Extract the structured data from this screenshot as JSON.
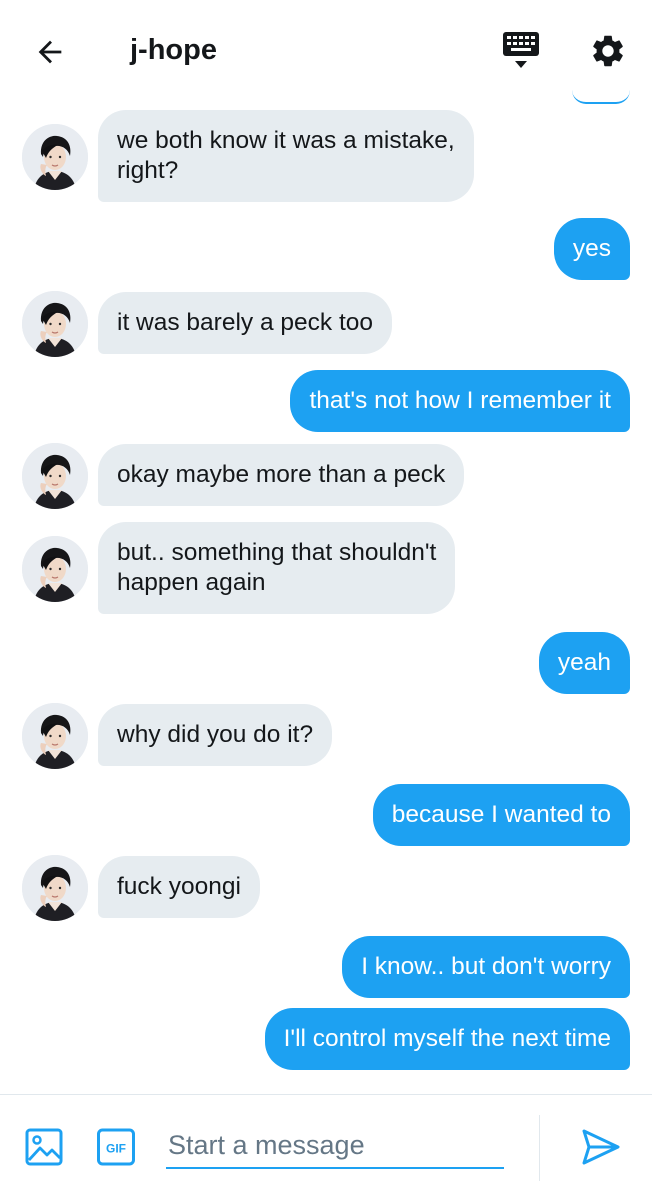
{
  "header": {
    "title": "j-hope",
    "back_icon": "arrow-left-icon",
    "keyboard_icon": "keyboard-icon",
    "settings_icon": "gear-icon"
  },
  "colors": {
    "accent": "#1da1f2",
    "incoming_bubble": "#e6ecf0",
    "text": "#14171a",
    "placeholder": "#657786"
  },
  "messages": [
    {
      "side": "in",
      "lines": [
        "we both know it was a mistake,",
        "right?"
      ]
    },
    {
      "side": "out",
      "lines": [
        "yes"
      ]
    },
    {
      "side": "in",
      "lines": [
        "it was barely a peck too"
      ]
    },
    {
      "side": "out",
      "lines": [
        "that's not how I remember it"
      ]
    },
    {
      "side": "in",
      "lines": [
        "okay maybe more than a peck"
      ]
    },
    {
      "side": "in",
      "lines": [
        "but.. something that shouldn't",
        "happen again"
      ]
    },
    {
      "side": "out",
      "lines": [
        "yeah"
      ]
    },
    {
      "side": "in",
      "lines": [
        "why did you do it?"
      ]
    },
    {
      "side": "out",
      "lines": [
        "because I wanted to"
      ]
    },
    {
      "side": "in",
      "lines": [
        "fuck yoongi"
      ]
    },
    {
      "side": "out",
      "lines": [
        "I know.. but don't worry"
      ]
    },
    {
      "side": "out",
      "lines": [
        "I'll control myself the next time"
      ]
    }
  ],
  "composer": {
    "placeholder": "Start a message",
    "value": "",
    "media_icon": "image-icon",
    "gif_icon": "gif-icon",
    "gif_label": "GIF",
    "send_icon": "send-icon"
  }
}
